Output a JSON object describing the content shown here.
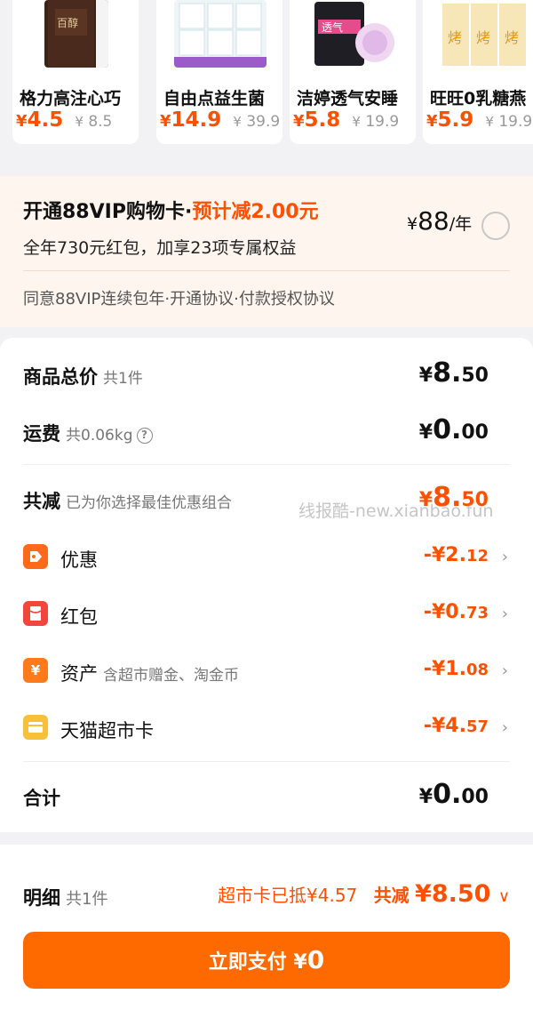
{
  "products": [
    {
      "name": "格力高注心巧",
      "currency": "¥",
      "price": "4.5",
      "orig_price": "8.5"
    },
    {
      "name": "自由点益生菌",
      "currency": "¥",
      "price": "14.9",
      "orig_price": "39.9"
    },
    {
      "name": "洁婷透气安睡",
      "currency": "¥",
      "price": "5.8",
      "orig_price": "19.9"
    },
    {
      "name": "旺旺0乳糖燕",
      "currency": "¥",
      "price": "5.9",
      "orig_price": "19.9"
    }
  ],
  "vip": {
    "title": "开通88VIP购物卡·",
    "saving": "预计减2.00元",
    "subtitle": "全年730元红包，加享23项专属权益",
    "price": "88",
    "unit": "/年",
    "agreement": "同意88VIP连续包年·开通协议·付款授权协议"
  },
  "summary": {
    "goods_total_label": "商品总价",
    "goods_total_note": "共1件",
    "goods_total_int": "8.",
    "goods_total_dec": "50",
    "shipping_label": "运费",
    "shipping_note": "共0.06kg",
    "shipping_int": "0.",
    "shipping_dec": "00",
    "total_discount_label": "共减",
    "total_discount_note": "已为你选择最佳优惠组合",
    "total_discount_int": "8.",
    "total_discount_dec": "50",
    "watermark": "线报酷-new.xianbao.fun",
    "discounts": [
      {
        "label": "优惠",
        "note": "",
        "int": "2.",
        "dec": "12",
        "icon": "tag-icon",
        "color": "#ff6a1a"
      },
      {
        "label": "红包",
        "note": "",
        "int": "0.",
        "dec": "73",
        "icon": "red-packet-icon",
        "color": "#f0463c"
      },
      {
        "label": "资产",
        "note": "含超市赠金、淘金币",
        "int": "1.",
        "dec": "08",
        "icon": "asset-yen-icon",
        "color": "#ff7a1a"
      },
      {
        "label": "天猫超市卡",
        "note": "",
        "int": "4.",
        "dec": "57",
        "icon": "card-icon",
        "color": "#f6c03a"
      }
    ],
    "total_label": "合计",
    "total_int": "0.",
    "total_dec": "00"
  },
  "footer": {
    "detail_label": "明细",
    "detail_note": "共1件",
    "card_deducted": "超市卡已抵¥4.57",
    "total_discount_label": "共减",
    "total_discount": "¥8.50",
    "pay_label": "立即支付 ¥",
    "pay_amount": "0"
  },
  "symbols": {
    "yen": "¥",
    "minus_yen": "-¥",
    "chevron": "›",
    "expand": "∨"
  }
}
